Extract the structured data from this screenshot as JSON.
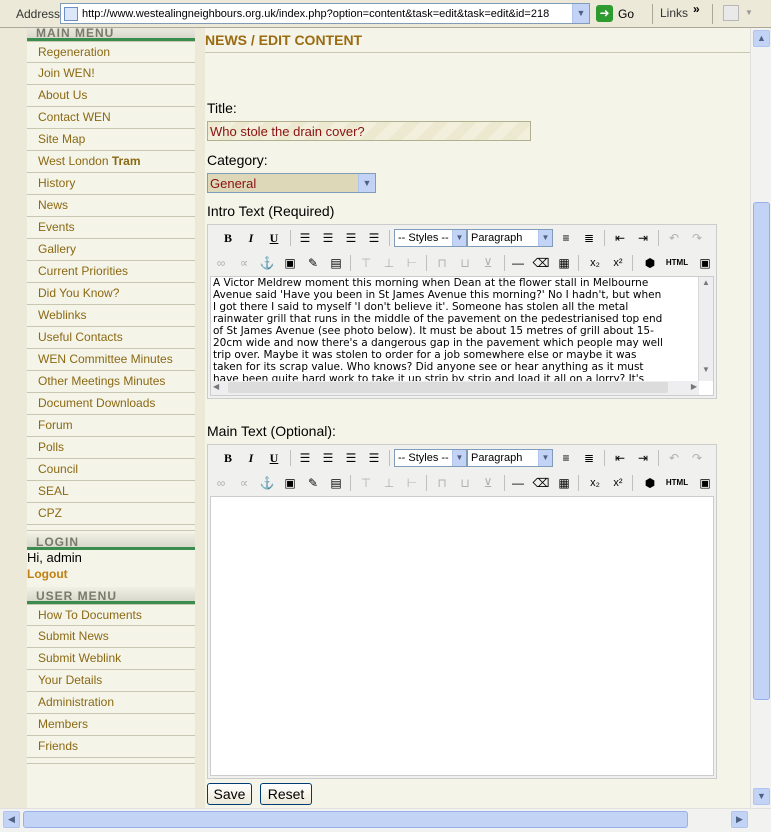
{
  "address_bar": {
    "label": "Address",
    "url": "http://www.westealingneighbours.org.uk/index.php?option=content&task=edit&task=edit&id=218",
    "go_label": "Go",
    "links_label": "Links",
    "chevron": "»"
  },
  "sidebar": {
    "main_menu_title": "MAIN MENU",
    "main_menu_items": [
      {
        "label": "Regeneration"
      },
      {
        "label": "Join WEN!"
      },
      {
        "label": "About Us"
      },
      {
        "label": "Contact WEN"
      },
      {
        "label": "Site Map"
      },
      {
        "label": "West London ",
        "bold": "Tram"
      },
      {
        "label": "History"
      },
      {
        "label": "News"
      },
      {
        "label": "Events"
      },
      {
        "label": "Gallery"
      },
      {
        "label": "Current Priorities"
      },
      {
        "label": "Did You Know?"
      },
      {
        "label": "Weblinks"
      },
      {
        "label": "Useful Contacts"
      },
      {
        "label": "WEN Committee Minutes"
      },
      {
        "label": "Other Meetings Minutes"
      },
      {
        "label": "Document Downloads"
      },
      {
        "label": "Forum"
      },
      {
        "label": "Polls"
      },
      {
        "label": "Council"
      },
      {
        "label": "SEAL"
      },
      {
        "label": "CPZ"
      }
    ],
    "login_title": "LOGIN",
    "greeting": "Hi, admin",
    "logout_label": "Logout",
    "user_menu_title": "USER MENU",
    "user_menu_items": [
      {
        "label": "How To Documents"
      },
      {
        "label": "Submit News"
      },
      {
        "label": "Submit Weblink"
      },
      {
        "label": "Your Details"
      },
      {
        "label": "Administration"
      },
      {
        "label": "Members"
      },
      {
        "label": "Friends"
      }
    ]
  },
  "main": {
    "heading_part1": "NEWS",
    "heading_sep": "/",
    "heading_part2": "EDIT CONTENT",
    "title_label": "Title:",
    "title_value": "Who stole the drain cover?",
    "category_label": "Category:",
    "category_value": "General",
    "intro_label": "Intro Text (Required)",
    "intro_text": "A Victor Meldrew moment this morning when Dean at the flower stall in Melbourne\nAvenue said 'Have you been in St James Avenue this morning?' No I hadn't, but when\nI got there I said to myself 'I don't believe it'.  Someone has stolen all the metal\nrainwater grill that runs in the middle of the pavement on the pedestrianised top end\nof St James Avenue (see photo below).  It must be about 15 metres of grill about 15-\n20cm wide and now there's a dangerous gap in the pavement which people may well\ntrip over.  Maybe it was stolen to order for a job somewhere else or maybe it was\ntaken for its scrap value.  Who knows?  Did anyone see or hear anything as it must\nhave been quite hard work to take it up strip by strip and load it all on a lorry?  It's",
    "main_label": "Main Text (Optional):",
    "main_text": "",
    "save_label": "Save",
    "reset_label": "Reset"
  },
  "toolbar": {
    "bold": "B",
    "italic": "I",
    "underline": "U",
    "styles_value": "-- Styles --",
    "format_value": "Paragraph",
    "html_label": "HTML",
    "subscript": "x₂",
    "superscript": "x²"
  }
}
